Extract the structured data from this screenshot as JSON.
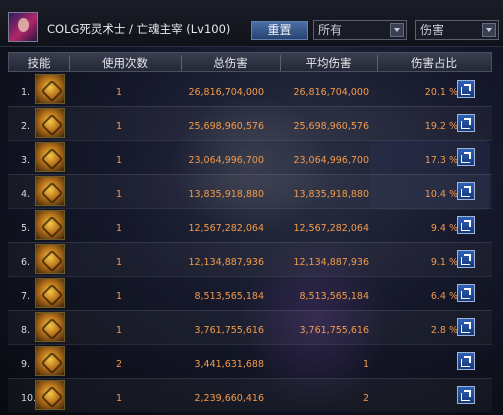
{
  "header": {
    "char_title": "COLG死灵术士 / 亡魂主宰 (Lv100)",
    "reset_label": "重置",
    "filter_value": "所有",
    "sort_value": "伤害"
  },
  "table": {
    "columns": [
      "技能",
      "使用次数",
      "总伤害",
      "平均伤害",
      "伤害占比"
    ],
    "rows": [
      {
        "rank": "1.",
        "uses": "1",
        "total": "26,816,704,000",
        "avg": "26,816,704,000",
        "pct": "20.1 %"
      },
      {
        "rank": "2.",
        "uses": "1",
        "total": "25,698,960,576",
        "avg": "25,698,960,576",
        "pct": "19.2 %"
      },
      {
        "rank": "3.",
        "uses": "1",
        "total": "23,064,996,700",
        "avg": "23,064,996,700",
        "pct": "17.3 %"
      },
      {
        "rank": "4.",
        "uses": "1",
        "total": "13,835,918,880",
        "avg": "13,835,918,880",
        "pct": "10.4 %"
      },
      {
        "rank": "5.",
        "uses": "1",
        "total": "12,567,282,064",
        "avg": "12,567,282,064",
        "pct": "9.4 %"
      },
      {
        "rank": "6.",
        "uses": "1",
        "total": "12,134,887,936",
        "avg": "12,134,887,936",
        "pct": "9.1 %"
      },
      {
        "rank": "7.",
        "uses": "1",
        "total": "8,513,565,184",
        "avg": "8,513,565,184",
        "pct": "6.4 %"
      },
      {
        "rank": "8.",
        "uses": "1",
        "total": "3,761,755,616",
        "avg": "3,761,755,616",
        "pct": "2.8 %"
      },
      {
        "rank": "9.",
        "uses": "2",
        "total": "3,441,631,688",
        "avg": "1",
        "pct": ""
      },
      {
        "rank": "10.",
        "uses": "1",
        "total": "2,239,660,416",
        "avg": "2",
        "pct": ""
      }
    ]
  },
  "colors": {
    "value_text": "#f39a4a",
    "header_bg": "#2a2e3c",
    "button_blue": "#3b5f98"
  }
}
